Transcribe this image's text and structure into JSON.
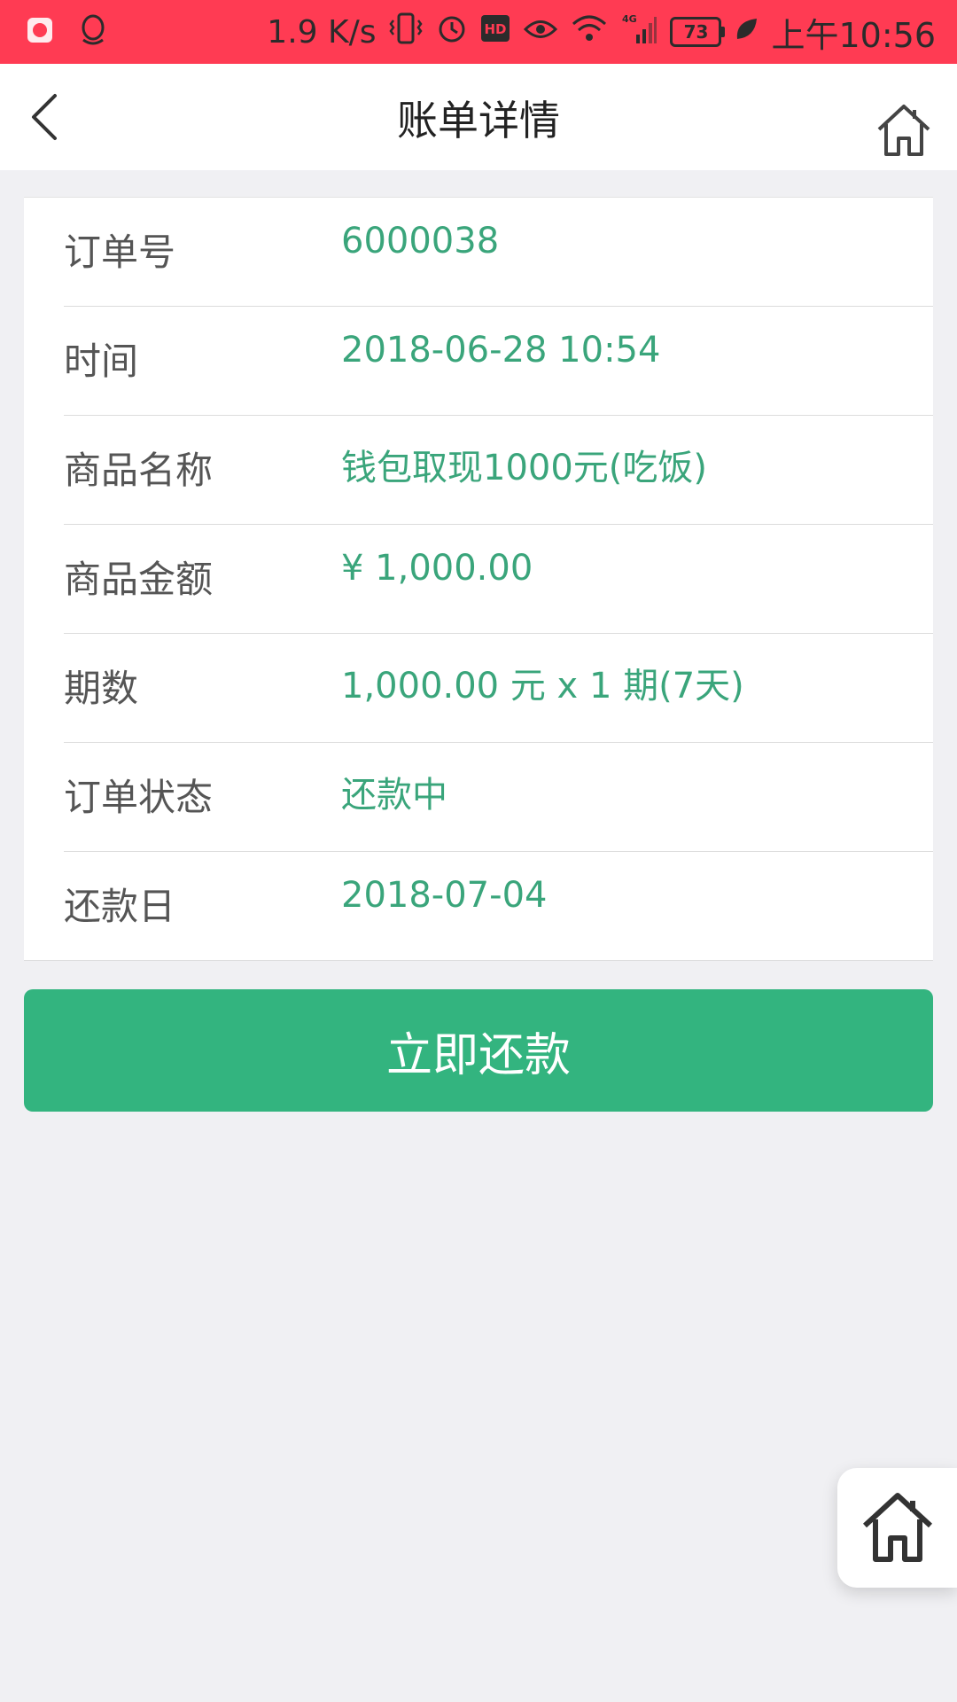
{
  "status_bar": {
    "speed": "1.9 K/s",
    "battery": "73",
    "time": "上午10:56",
    "icons": [
      "app-icon",
      "qq-icon",
      "vibrate-icon",
      "alarm-icon",
      "hd-icon",
      "eye-icon",
      "wifi-icon",
      "signal-4g-icon",
      "battery-icon",
      "leaf-icon"
    ]
  },
  "nav": {
    "title": "账单详情",
    "back_icon": "back-arrow-icon",
    "home_icon": "home-icon"
  },
  "details": [
    {
      "label": "订单号",
      "value": "6000038"
    },
    {
      "label": "时间",
      "value": "2018-06-28 10:54"
    },
    {
      "label": "商品名称",
      "value": "钱包取现1000元(吃饭)"
    },
    {
      "label": "商品金额",
      "value": "¥ 1,000.00"
    },
    {
      "label": "期数",
      "value": "1,000.00 元 x 1 期(7天)"
    },
    {
      "label": "订单状态",
      "value": "还款中"
    },
    {
      "label": "还款日",
      "value": "2018-07-04"
    }
  ],
  "pay_button": {
    "label": "立即还款"
  },
  "floating_home": {
    "icon": "home-icon"
  },
  "colors": {
    "status_bar": "#ff3b53",
    "accent_green": "#33b47f",
    "value_text": "#3aa57b",
    "background": "#f0f0f3"
  }
}
